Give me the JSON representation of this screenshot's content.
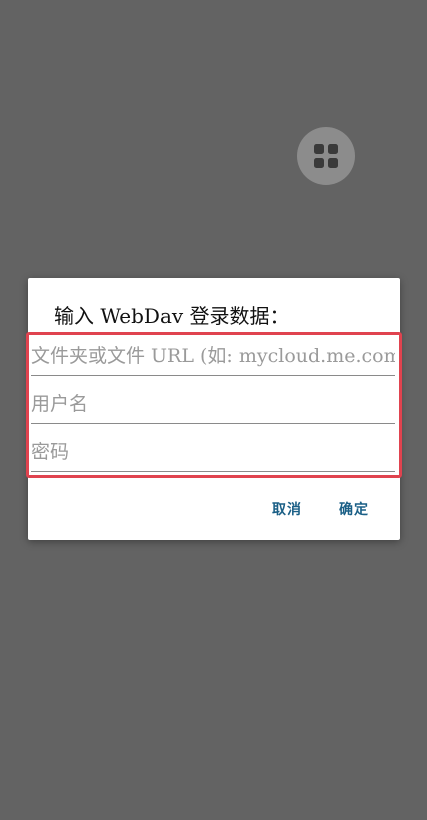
{
  "background_color": "#636363",
  "fab": {
    "icon": "grid-icon",
    "color": "#8c8c8c"
  },
  "dialog": {
    "title": "输入 WebDav 登录数据：",
    "fields": {
      "url_placeholder": "文件夹或文件 URL (如: mycloud.me.com/",
      "username_placeholder": "用户名",
      "password_placeholder": "密码"
    },
    "buttons": {
      "cancel": "取消",
      "ok": "确定"
    },
    "highlight_color": "#e0434f",
    "accent_color": "#1a5f86"
  }
}
